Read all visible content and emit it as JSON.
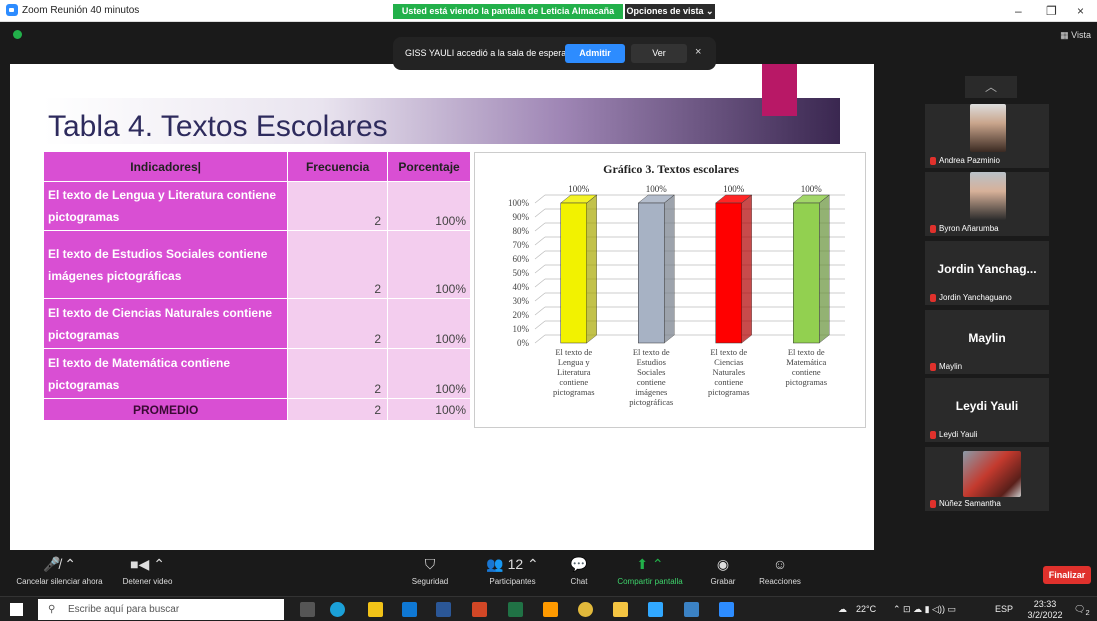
{
  "window": {
    "title": "Zoom Reunión 40 minutos",
    "viewing_banner": "Usted está viendo la pantalla de Leticia Almacaña",
    "view_options": "Opciones de vista ⌄",
    "view_label": "Vista"
  },
  "notification": {
    "message": "GISS YAULI accedió a la sala de espera",
    "admit_label": "Admitir",
    "view_label": "Ver",
    "close": "×"
  },
  "slide": {
    "title": "Tabla 4. Textos Escolares",
    "table": {
      "headers": [
        "Indicadores|",
        "Frecuencia",
        "Porcentaje"
      ],
      "rows": [
        {
          "indicator": "El texto de Lengua y Literatura contiene pictogramas",
          "freq": "2",
          "pct": "100%"
        },
        {
          "indicator": "El texto de Estudios Sociales contiene imágenes pictográficas",
          "freq": "2",
          "pct": "100%"
        },
        {
          "indicator": "El texto de Ciencias Naturales contiene pictogramas",
          "freq": "2",
          "pct": "100%"
        },
        {
          "indicator": "El texto de Matemática contiene pictogramas",
          "freq": "2",
          "pct": "100%"
        }
      ],
      "footer": {
        "label": "PROMEDIO",
        "freq": "2",
        "pct": "100%"
      }
    }
  },
  "chart_data": {
    "type": "bar",
    "title": "Gráfico 3. Textos escolares",
    "categories": [
      [
        "El texto de",
        "Lengua y",
        "Literatura",
        "contiene",
        "pictogramas"
      ],
      [
        "El texto de",
        "Estudios",
        "Sociales",
        "contiene",
        "imágenes",
        "pictográficas"
      ],
      [
        "El texto de",
        "Ciencias",
        "Naturales",
        "contiene",
        "pictogramas"
      ],
      [
        "El texto de",
        "Matemática",
        "contiene",
        "pictogramas"
      ]
    ],
    "values": [
      100,
      100,
      100,
      100
    ],
    "value_labels": [
      "100%",
      "100%",
      "100%",
      "100%"
    ],
    "colors": [
      "#f2f200",
      "#a7b2c4",
      "#ff0000",
      "#92d050"
    ],
    "yticks": [
      "0%",
      "10%",
      "20%",
      "30%",
      "40%",
      "50%",
      "60%",
      "70%",
      "80%",
      "90%",
      "100%"
    ],
    "ylim": [
      0,
      100
    ],
    "grid": true
  },
  "participants": [
    {
      "name": "Andrea Pazminio",
      "type": "video"
    },
    {
      "name": "Byron Añarumba",
      "type": "video"
    },
    {
      "name": "Jordin Yanchaguano",
      "display": "Jordin Yanchag...",
      "type": "name"
    },
    {
      "name": "Maylin",
      "display": "Maylin",
      "type": "name"
    },
    {
      "name": "Leydi Yauli",
      "display": "Leydi Yauli",
      "type": "name"
    },
    {
      "name": "Núñez Samantha",
      "type": "image"
    }
  ],
  "controls": {
    "mute": "Cancelar silenciar ahora",
    "video": "Detener video",
    "security": "Seguridad",
    "participants": "Participantes",
    "participants_count": "12",
    "chat": "Chat",
    "share": "Compartir pantalla",
    "record": "Grabar",
    "reactions": "Reacciones",
    "end": "Finalizar"
  },
  "taskbar": {
    "search_placeholder": "Escribe aquí para buscar",
    "weather": "22°C",
    "lang": "ESP",
    "time": "23:33",
    "date": "3/2/2022",
    "notif_count": "2"
  }
}
